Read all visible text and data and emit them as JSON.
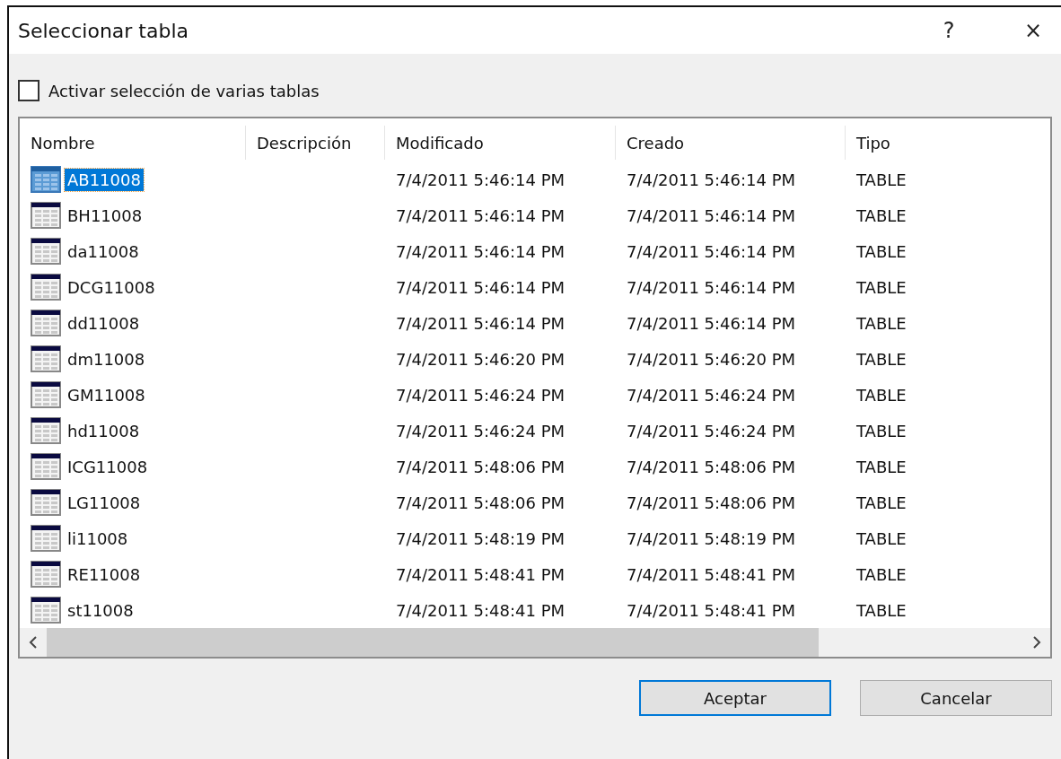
{
  "window": {
    "title": "Seleccionar tabla",
    "help": "?",
    "close": "×"
  },
  "multi_select": {
    "label": "Activar selección de varias tablas",
    "checked": false
  },
  "table": {
    "columns": [
      "Nombre",
      "Descripción",
      "Modificado",
      "Creado",
      "Tipo"
    ],
    "rows": [
      {
        "name": "AB11008",
        "modified": "7/4/2011 5:46:14 PM",
        "created": "7/4/2011 5:46:14 PM",
        "type": "TABLE",
        "selected": true
      },
      {
        "name": "BH11008",
        "modified": "7/4/2011 5:46:14 PM",
        "created": "7/4/2011 5:46:14 PM",
        "type": "TABLE",
        "selected": false
      },
      {
        "name": "da11008",
        "modified": "7/4/2011 5:46:14 PM",
        "created": "7/4/2011 5:46:14 PM",
        "type": "TABLE",
        "selected": false
      },
      {
        "name": "DCG11008",
        "modified": "7/4/2011 5:46:14 PM",
        "created": "7/4/2011 5:46:14 PM",
        "type": "TABLE",
        "selected": false
      },
      {
        "name": "dd11008",
        "modified": "7/4/2011 5:46:14 PM",
        "created": "7/4/2011 5:46:14 PM",
        "type": "TABLE",
        "selected": false
      },
      {
        "name": "dm11008",
        "modified": "7/4/2011 5:46:20 PM",
        "created": "7/4/2011 5:46:20 PM",
        "type": "TABLE",
        "selected": false
      },
      {
        "name": "GM11008",
        "modified": "7/4/2011 5:46:24 PM",
        "created": "7/4/2011 5:46:24 PM",
        "type": "TABLE",
        "selected": false
      },
      {
        "name": "hd11008",
        "modified": "7/4/2011 5:46:24 PM",
        "created": "7/4/2011 5:46:24 PM",
        "type": "TABLE",
        "selected": false
      },
      {
        "name": "ICG11008",
        "modified": "7/4/2011 5:48:06 PM",
        "created": "7/4/2011 5:48:06 PM",
        "type": "TABLE",
        "selected": false
      },
      {
        "name": "LG11008",
        "modified": "7/4/2011 5:48:06 PM",
        "created": "7/4/2011 5:48:06 PM",
        "type": "TABLE",
        "selected": false
      },
      {
        "name": "li11008",
        "modified": "7/4/2011 5:48:19 PM",
        "created": "7/4/2011 5:48:19 PM",
        "type": "TABLE",
        "selected": false
      },
      {
        "name": "RE11008",
        "modified": "7/4/2011 5:48:41 PM",
        "created": "7/4/2011 5:48:41 PM",
        "type": "TABLE",
        "selected": false
      },
      {
        "name": "st11008",
        "modified": "7/4/2011 5:48:41 PM",
        "created": "7/4/2011 5:48:41 PM",
        "type": "TABLE",
        "selected": false
      }
    ]
  },
  "buttons": [
    {
      "label": "Aceptar",
      "kind": "default"
    },
    {
      "label": "Cancelar",
      "kind": "normal"
    }
  ]
}
